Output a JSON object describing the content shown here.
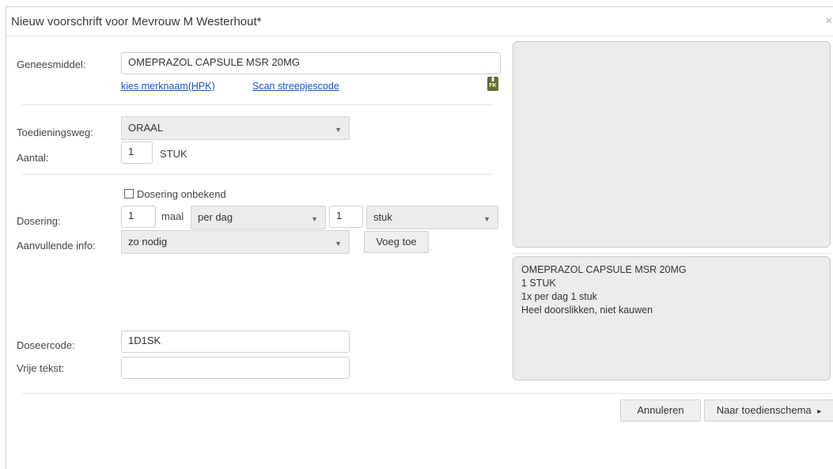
{
  "dialog": {
    "title": "Nieuw voorschrift voor Mevrouw M Westerhout*",
    "close": "×"
  },
  "form": {
    "geneesmiddel": {
      "label": "Geneesmiddel:",
      "value": "OMEPRAZOL CAPSULE MSR 20MG"
    },
    "links": {
      "kies_merknaam": "kies merknaam(HPK)",
      "scan": "Scan streepjescode"
    },
    "fk_badge": "FK",
    "toedieningsweg": {
      "label": "Toedieningsweg:",
      "value": "ORAAL"
    },
    "aantal": {
      "label": "Aantal:",
      "value": "1",
      "unit": "STUK"
    },
    "dosering_onbekend": {
      "label": "Dosering onbekend",
      "checked": false
    },
    "dosering": {
      "label": "Dosering:",
      "count": "1",
      "maal": "maal",
      "period": "per dag",
      "amount": "1",
      "unit": "stuk"
    },
    "aanvullende_info": {
      "label": "Aanvullende info:",
      "value": "zo nodig",
      "button": "Voeg toe"
    },
    "doseercode": {
      "label": "Doseercode:",
      "value": "1D1SK"
    },
    "vrije_tekst": {
      "label": "Vrije tekst:",
      "value": ""
    }
  },
  "summary": {
    "lines": [
      "OMEPRAZOL CAPSULE MSR 20MG",
      "1 STUK",
      "1x per dag 1 stuk",
      "Heel doorslikken, niet kauwen"
    ]
  },
  "footer": {
    "cancel": "Annuleren",
    "next": "Naar toedienschema",
    "next_arrow": "▸"
  },
  "icons": {
    "dropdown_arrow": "▼"
  }
}
